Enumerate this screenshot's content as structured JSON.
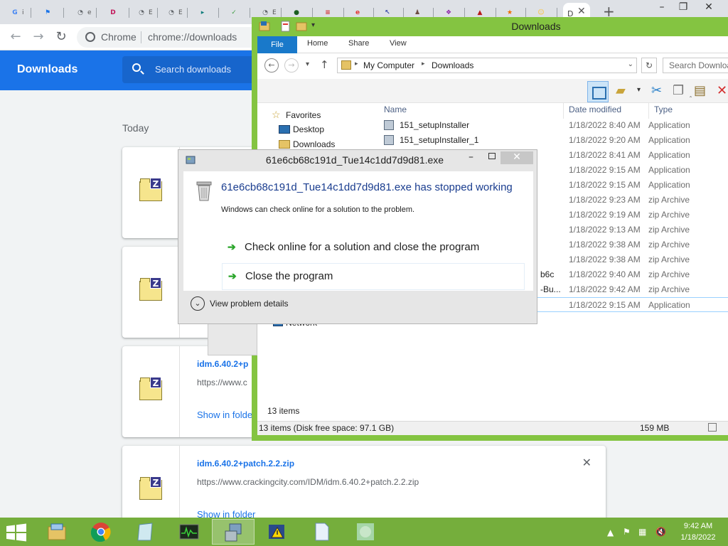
{
  "colors": {
    "accent": "#1a73e8",
    "explorer_frame": "#84c441",
    "taskbar": "#75ae3c"
  },
  "chrome": {
    "tabs": [
      {
        "letter": "G",
        "text": "i",
        "color": "#4285f4"
      },
      {
        "letter": "⚑",
        "text": "",
        "color": "#1a73e8"
      },
      {
        "letter": "◔",
        "text": "e",
        "color": "#5f6368"
      },
      {
        "letter": "D",
        "text": "",
        "color": "#c2185b"
      },
      {
        "letter": "◔",
        "text": "E",
        "color": "#5f6368"
      },
      {
        "letter": "◔",
        "text": "E",
        "color": "#5f6368"
      },
      {
        "letter": "▸",
        "text": "",
        "color": "#0e7c7b"
      },
      {
        "letter": "✓",
        "text": "",
        "color": "#43a047"
      },
      {
        "letter": "◔",
        "text": "E",
        "color": "#5f6368"
      },
      {
        "letter": "●",
        "text": "",
        "color": "#1b5e20"
      },
      {
        "letter": "≡",
        "text": "",
        "color": "#d32f2f"
      },
      {
        "letter": "e",
        "text": "",
        "color": "#e53935"
      },
      {
        "letter": "↖",
        "text": "",
        "color": "#3949ab"
      },
      {
        "letter": "♟",
        "text": "",
        "color": "#6d4c41"
      },
      {
        "letter": "❖",
        "text": "",
        "color": "#8e24aa"
      },
      {
        "letter": "▲",
        "text": "",
        "color": "#b71c1c"
      },
      {
        "letter": "★",
        "text": "",
        "color": "#ef6c00"
      },
      {
        "letter": "☺",
        "text": "",
        "color": "#fbc02d"
      }
    ],
    "active_tab_text": "D",
    "omnibox_label": "Chrome",
    "omnibox_url": "chrome://downloads"
  },
  "downloads": {
    "title": "Downloads",
    "search_placeholder": "Search downloads",
    "section": "Today",
    "items": [
      {
        "name": "",
        "url": "",
        "show": ""
      },
      {
        "name": "",
        "url": "",
        "show": ""
      },
      {
        "name": "idm.6.40.2+p",
        "url": "https://www.c",
        "show": "Show in folde"
      },
      {
        "name": "idm.6.40.2+patch.2.2.zip",
        "url": "https://www.crackingcity.com/IDM/idm.6.40.2+patch.2.2.zip",
        "show": "Show in folder"
      }
    ]
  },
  "explorer": {
    "title": "Downloads",
    "ribbon": {
      "file": "File",
      "home": "Home",
      "share": "Share",
      "view": "View"
    },
    "breadcrumb": [
      "My Computer",
      "Downloads"
    ],
    "search_placeholder": "Search Downloads",
    "nav": {
      "favorites": "Favorites",
      "desktop": "Desktop",
      "downloads": "Downloads",
      "network": "Network"
    },
    "columns": {
      "name": "Name",
      "date": "Date modified",
      "type": "Type"
    },
    "files": [
      {
        "name": "151_setupInstaller",
        "date": "1/18/2022 8:40 AM",
        "type": "Application"
      },
      {
        "name": "151_setupInstaller_1",
        "date": "1/18/2022 9:20 AM",
        "type": "Application"
      },
      {
        "name": "",
        "date": "1/18/2022 8:41 AM",
        "type": "Application"
      },
      {
        "name": "",
        "date": "1/18/2022 9:15 AM",
        "type": "Application"
      },
      {
        "name": "",
        "date": "1/18/2022 9:15 AM",
        "type": "Application"
      },
      {
        "name": "",
        "date": "1/18/2022 9:23 AM",
        "type": "zip Archive"
      },
      {
        "name": "",
        "date": "1/18/2022 9:19 AM",
        "type": "zip Archive"
      },
      {
        "name": "",
        "date": "1/18/2022 9:13 AM",
        "type": "zip Archive"
      },
      {
        "name": "",
        "date": "1/18/2022 9:38 AM",
        "type": "zip Archive"
      },
      {
        "name": "",
        "date": "1/18/2022 9:38 AM",
        "type": "zip Archive"
      },
      {
        "name": "b6c",
        "date": "1/18/2022 9:40 AM",
        "type": "zip Archive"
      },
      {
        "name": "-Bu...",
        "date": "1/18/2022 9:42 AM",
        "type": "zip Archive"
      },
      {
        "name": "",
        "date": "1/18/2022 9:15 AM",
        "type": "Application"
      }
    ],
    "item_count": "13 items",
    "status_space": "13 items (Disk free space: 97.1 GB)",
    "status_size": "159 MB"
  },
  "dialog": {
    "title": "61e6cb68c191d_Tue14c1dd7d9d81.exe",
    "heading": "61e6cb68c191d_Tue14c1dd7d9d81.exe has stopped working",
    "sub": "Windows can check online for a solution to the problem.",
    "option_check": "Check online for a solution and close the program",
    "option_close": "Close the program",
    "details": "View problem details"
  },
  "taskbar": {
    "time": "9:42 AM",
    "date": "1/18/2022",
    "apps": [
      "file-explorer-icon",
      "chrome-icon",
      "notepad-icon",
      "task-manager-icon",
      "installer-icon",
      "warning-shield-icon",
      "document-icon",
      "app-icon"
    ]
  }
}
